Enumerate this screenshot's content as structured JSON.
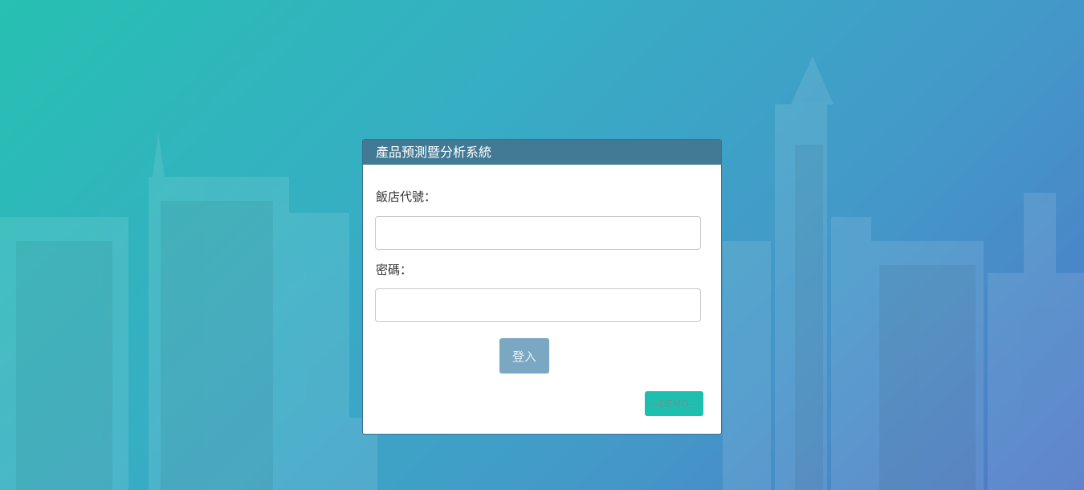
{
  "panel": {
    "title": "產品預測暨分析系統"
  },
  "form": {
    "hotel_code_label": "飯店代號：",
    "hotel_code_value": "",
    "password_label": "密碼：",
    "password_value": "",
    "login_label": "登入",
    "demo_label": "--DEMO--"
  },
  "colors": {
    "header_bg": "#427994",
    "login_button": "#7aa8c2",
    "demo_button": "#1fbfb0",
    "gradient_start": "#27c0b2",
    "gradient_end": "#4f77c6"
  }
}
